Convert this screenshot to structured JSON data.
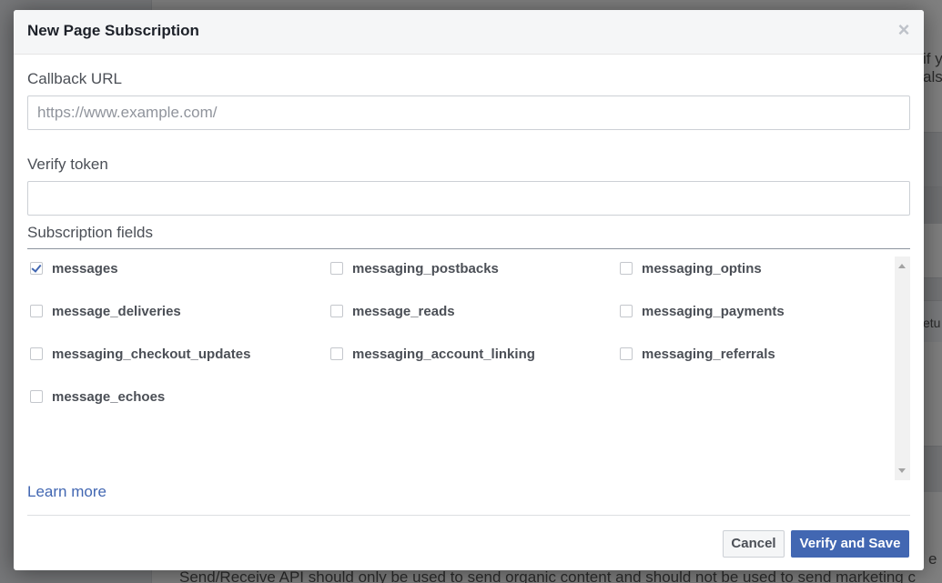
{
  "background": {
    "text_fragments": [
      "if y",
      "also",
      "etu",
      "e"
    ],
    "bottom_text": "Send/Receive API should only be used to send organic content and should not be used to send marketing c"
  },
  "dialog": {
    "title": "New Page Subscription",
    "close_glyph": "×",
    "callback_url": {
      "label": "Callback URL",
      "value": "",
      "placeholder": "https://www.example.com/"
    },
    "verify_token": {
      "label": "Verify token",
      "value": "",
      "placeholder": ""
    },
    "subscription_fields": {
      "label": "Subscription fields",
      "fields": [
        {
          "name": "messages",
          "checked": true
        },
        {
          "name": "messaging_postbacks",
          "checked": false
        },
        {
          "name": "messaging_optins",
          "checked": false
        },
        {
          "name": "message_deliveries",
          "checked": false
        },
        {
          "name": "message_reads",
          "checked": false
        },
        {
          "name": "messaging_payments",
          "checked": false
        },
        {
          "name": "messaging_checkout_updates",
          "checked": false
        },
        {
          "name": "messaging_account_linking",
          "checked": false
        },
        {
          "name": "messaging_referrals",
          "checked": false
        },
        {
          "name": "message_echoes",
          "checked": false
        }
      ]
    },
    "learn_more": "Learn more",
    "cancel_label": "Cancel",
    "save_label": "Verify and Save"
  },
  "colors": {
    "primary": "#4267b2",
    "text": "#4b4f56",
    "title": "#1d2129"
  }
}
